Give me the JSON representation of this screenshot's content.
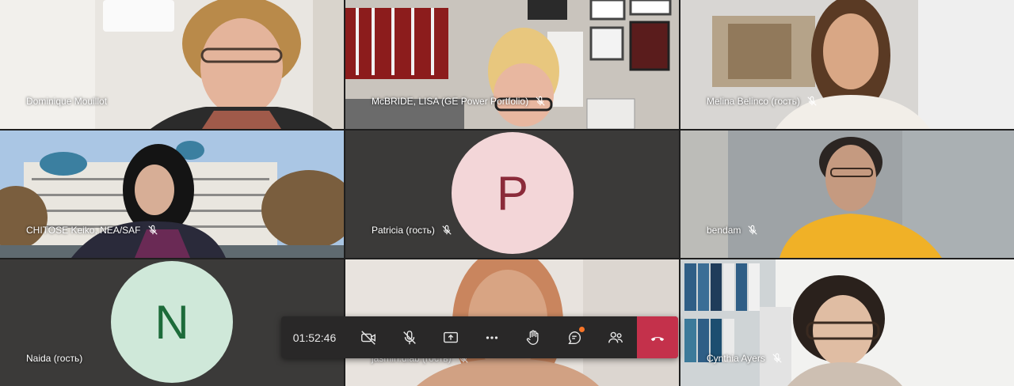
{
  "participants": [
    {
      "name": "Dominique Mouillot",
      "muted": false
    },
    {
      "name": "McBRIDE, LISA (GE Power Portfolio)",
      "muted": true
    },
    {
      "name": "Melina Belinco (гость)",
      "muted": true
    },
    {
      "name": "CHITOSE Keiko, NEA/SAF",
      "muted": true
    },
    {
      "name": "Patricia (гость)",
      "muted": true,
      "initial": "P",
      "avatar_bg": "#f3d6d8",
      "avatar_fg": "#8b2b3a"
    },
    {
      "name": "bendam",
      "muted": true
    },
    {
      "name": "Naida (гость)",
      "muted": false,
      "initial": "N",
      "avatar_bg": "#cfe8d9",
      "avatar_fg": "#1d6b3a"
    },
    {
      "name": "jasmin.diab (гость)",
      "muted": true
    },
    {
      "name": "Cynthia Ayers",
      "muted": true
    }
  ],
  "toolbar": {
    "timer": "01:52:46",
    "buttons": [
      "camera-off-icon",
      "mic-off-icon",
      "share-screen-icon",
      "more-icon",
      "raise-hand-icon",
      "chat-icon",
      "participants-icon",
      "hang-up-icon"
    ],
    "hangup_color": "#c4314b"
  }
}
